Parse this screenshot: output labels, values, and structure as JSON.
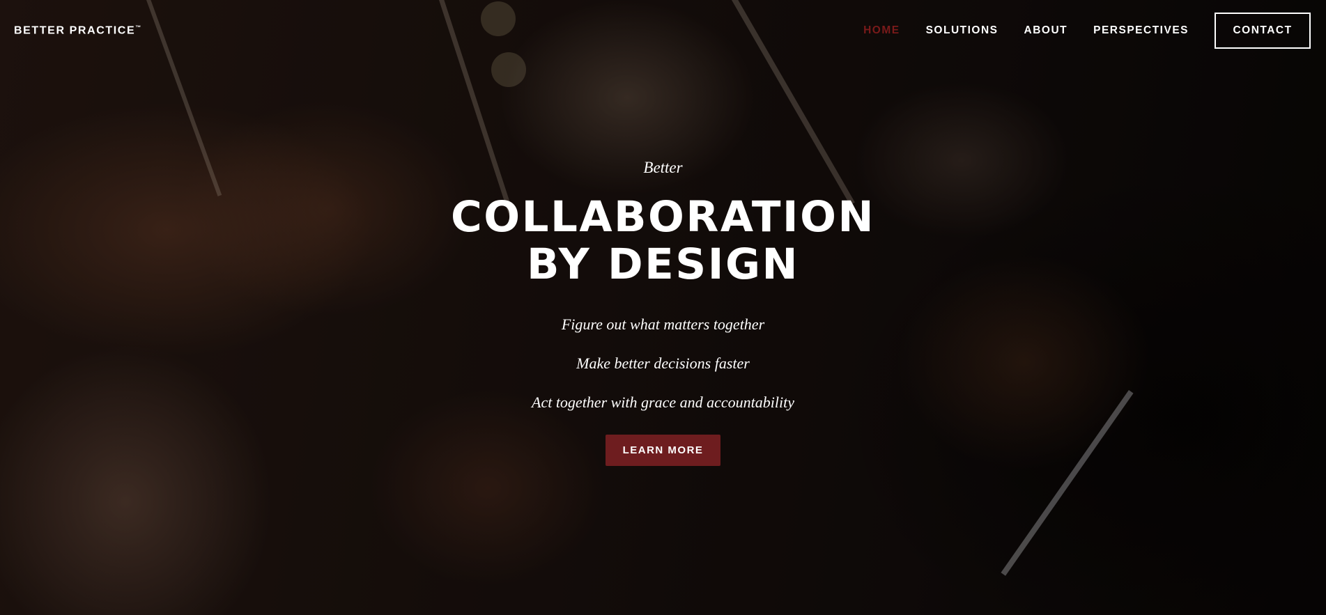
{
  "header": {
    "logo": "BETTER PRACTICE",
    "logo_mark": "™",
    "nav": [
      {
        "label": "HOME",
        "active": true
      },
      {
        "label": "SOLUTIONS",
        "active": false
      },
      {
        "label": "ABOUT",
        "active": false
      },
      {
        "label": "PERSPECTIVES",
        "active": false
      }
    ],
    "contact_label": "CONTACT"
  },
  "hero": {
    "eyebrow": "Better",
    "headline_line1": "COLLABORATION",
    "headline_line2": "BY DESIGN",
    "taglines": [
      "Figure out what matters together",
      "Make better decisions faster",
      "Act together with grace and accountability"
    ],
    "cta_label": "LEARN MORE",
    "background_image": "orchestra violinists photo"
  },
  "colors": {
    "accent": "#6e1d1f",
    "active_nav": "#7a1a1a",
    "text": "#ffffff"
  }
}
